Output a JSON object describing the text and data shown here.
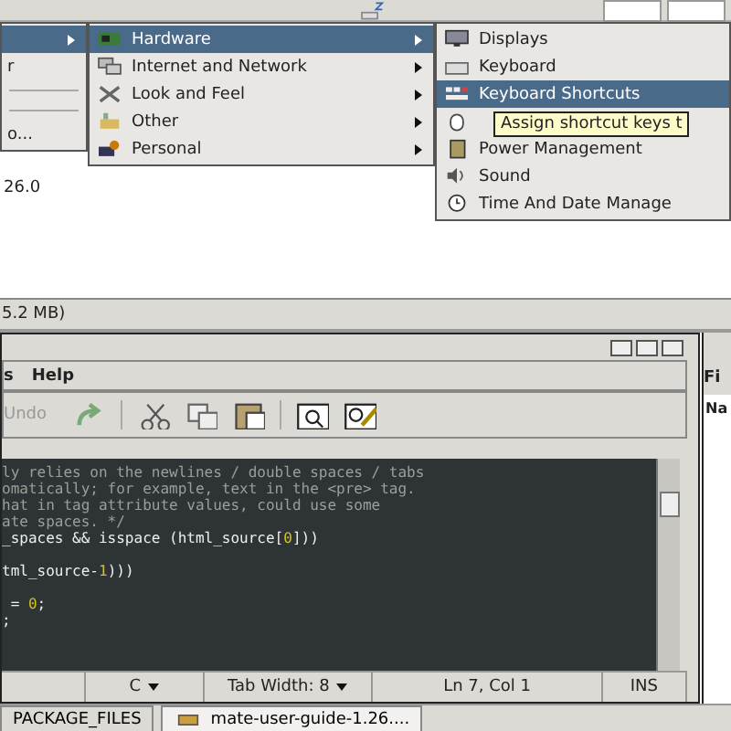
{
  "background_window": {
    "version_text": "26.0",
    "status_text": "5.2 MB)"
  },
  "menus": [
    {
      "items": [
        {
          "kind": "item",
          "selected": true,
          "submenu": true
        },
        {
          "kind": "item",
          "label": "r",
          "selected": false,
          "submenu": false
        },
        {
          "kind": "separator"
        },
        {
          "kind": "separator"
        },
        {
          "kind": "item",
          "label": "o...",
          "selected": false,
          "submenu": false
        }
      ]
    },
    {
      "items": [
        {
          "kind": "item",
          "label": "Hardware",
          "selected": true,
          "submenu": true
        },
        {
          "kind": "item",
          "label": "Internet and Network",
          "selected": false,
          "submenu": true
        },
        {
          "kind": "item",
          "label": "Look and Feel",
          "selected": false,
          "submenu": true
        },
        {
          "kind": "item",
          "label": "Other",
          "selected": false,
          "submenu": true
        },
        {
          "kind": "item",
          "label": "Personal",
          "selected": false,
          "submenu": true
        }
      ]
    },
    {
      "items": [
        {
          "kind": "item",
          "label": "Displays",
          "selected": false,
          "submenu": false
        },
        {
          "kind": "item",
          "label": "Keyboard",
          "selected": false,
          "submenu": false
        },
        {
          "kind": "item",
          "label": "Keyboard Shortcuts",
          "selected": true,
          "submenu": false
        },
        {
          "kind": "item",
          "selected": false,
          "submenu": false
        },
        {
          "kind": "item",
          "label": "Power Management",
          "selected": false,
          "submenu": false
        },
        {
          "kind": "item",
          "label": "Sound",
          "selected": false,
          "submenu": false
        },
        {
          "kind": "item",
          "label": "Time And Date Manage",
          "selected": false,
          "submenu": false
        }
      ]
    }
  ],
  "tooltip": {
    "text": "Assign shortcut keys t"
  },
  "editor": {
    "menubar": [
      "s",
      "Help"
    ],
    "toolbar": [
      {
        "kind": "text",
        "label": "Undo",
        "disabled": true
      },
      {
        "kind": "icon"
      },
      {
        "kind": "separator"
      },
      {
        "kind": "icon"
      },
      {
        "kind": "icon"
      },
      {
        "kind": "icon"
      },
      {
        "kind": "separator"
      },
      {
        "kind": "icon"
      },
      {
        "kind": "icon"
      }
    ],
    "code_lines": [
      {
        "gap_before": false,
        "segments": [
          {
            "kind": "comment",
            "text": "ly relies on the newlines / double spaces / tabs"
          }
        ]
      },
      {
        "gap_before": false,
        "segments": [
          {
            "kind": "comment",
            "text": "omatically; for example, text in the <pre> tag."
          }
        ]
      },
      {
        "gap_before": false,
        "segments": [
          {
            "kind": "comment",
            "text": "hat in tag attribute values, could use some"
          }
        ]
      },
      {
        "gap_before": false,
        "segments": [
          {
            "kind": "comment",
            "text": "ate spaces. */"
          }
        ]
      },
      {
        "gap_before": false,
        "segments": [
          {
            "kind": "code",
            "text": "_spaces && isspace (html_source["
          },
          {
            "kind": "number",
            "text": "0"
          },
          {
            "kind": "code",
            "text": "]))"
          }
        ]
      },
      {
        "gap_before": true,
        "segments": [
          {
            "kind": "code",
            "text": "tml_source-"
          },
          {
            "kind": "number",
            "text": "1"
          },
          {
            "kind": "code",
            "text": ")))"
          }
        ]
      },
      {
        "gap_before": true,
        "segments": [
          {
            "kind": "code",
            "text": " = "
          },
          {
            "kind": "number",
            "text": "0"
          },
          {
            "kind": "code",
            "text": ";"
          }
        ]
      },
      {
        "gap_before": false,
        "segments": [
          {
            "kind": "code",
            "text": ";"
          }
        ]
      }
    ],
    "status_bar": [
      {
        "label": "C",
        "dropdown": true
      },
      {
        "label": "Tab Width:  8",
        "dropdown": true
      },
      {
        "label": "Ln 7, Col 1",
        "dropdown": false
      },
      {
        "label": "INS",
        "dropdown": false
      }
    ]
  },
  "side_window": {
    "menu": "Fi",
    "column": "Na"
  },
  "taskbar": [
    {
      "label": "PACKAGE_FILES",
      "selected": false,
      "icon": false
    },
    {
      "label": "mate-user-guide-1.26....",
      "selected": true,
      "icon": true
    }
  ]
}
